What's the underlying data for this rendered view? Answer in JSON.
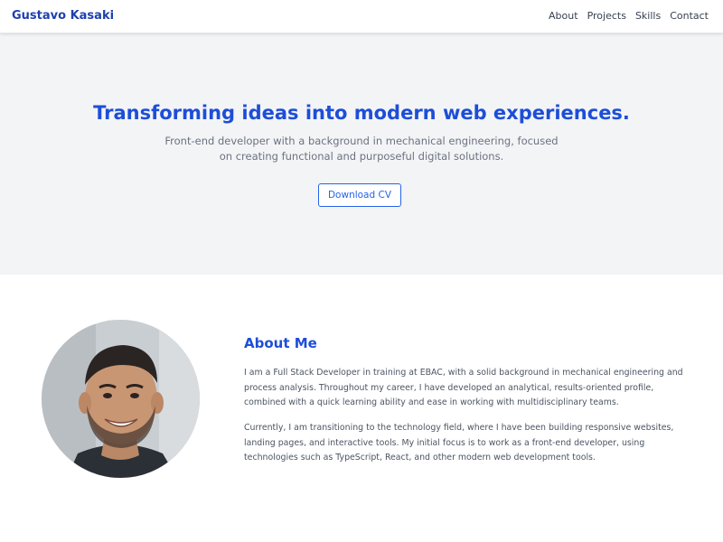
{
  "header": {
    "brand": "Gustavo Kasaki",
    "nav": [
      "About",
      "Projects",
      "Skills",
      "Contact"
    ]
  },
  "hero": {
    "title": "Transforming ideas into modern web experiences.",
    "subtitle": "Front-end developer with a background in mechanical engineering, focused on creating functional and purposeful digital solutions.",
    "button_label": "Download CV"
  },
  "about": {
    "title": "About Me",
    "paragraphs": [
      "I am a Full Stack Developer in training at EBAC, with a solid background in mechanical engineering and process analysis. Throughout my career, I have developed an analytical, results-oriented profile, combined with a quick learning ability and ease in working with multidisciplinary teams.",
      "Currently, I am transitioning to the technology field, where I have been building responsive websites, landing pages, and interactive tools. My initial focus is to work as a front-end developer, using technologies such as TypeScript, React, and other modern web development tools."
    ]
  },
  "colors": {
    "accent": "#1d4ed8",
    "hero_bg": "#f3f4f6",
    "text": "#4b5563"
  }
}
